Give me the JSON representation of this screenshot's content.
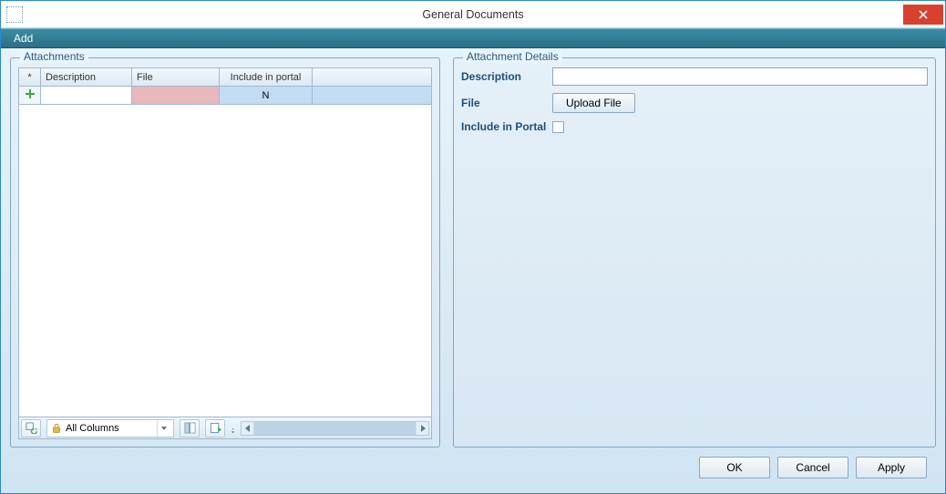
{
  "window": {
    "title": "General Documents"
  },
  "menubar": {
    "items": [
      "Add"
    ]
  },
  "left": {
    "legend": "Attachments",
    "columns": {
      "star": "*",
      "description": "Description",
      "file": "File",
      "include": "Include in portal"
    },
    "row": {
      "description_value": "",
      "file_value": "",
      "include_value": "N"
    },
    "toolbar": {
      "filter_label": "All Columns"
    }
  },
  "right": {
    "legend": "Attachment Details",
    "labels": {
      "description": "Description",
      "file": "File",
      "include": "Include in Portal"
    },
    "values": {
      "description": ""
    },
    "buttons": {
      "upload": "Upload File"
    }
  },
  "footer": {
    "ok": "OK",
    "cancel": "Cancel",
    "apply": "Apply"
  }
}
